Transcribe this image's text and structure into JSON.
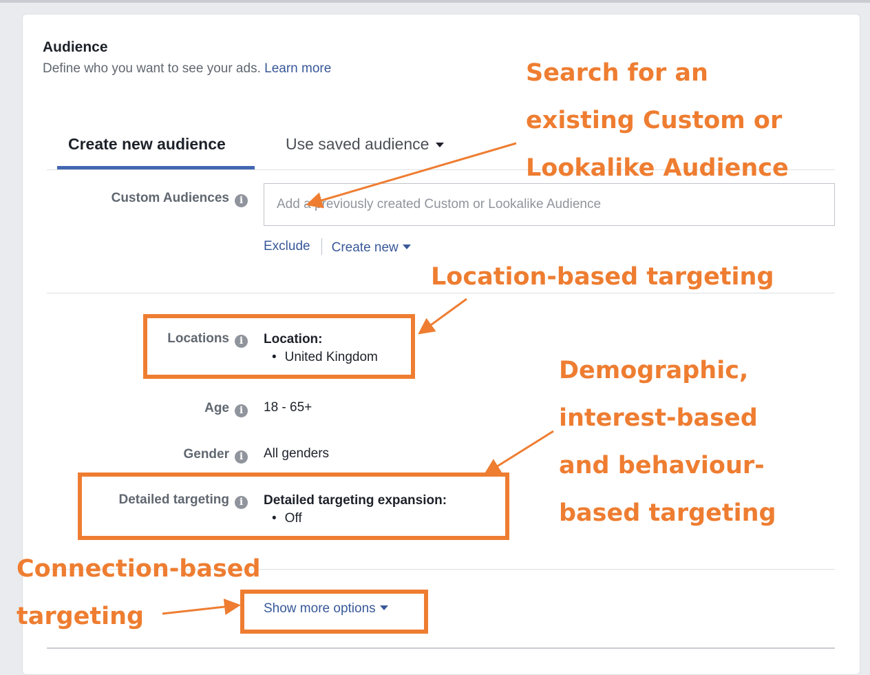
{
  "audience": {
    "title": "Audience",
    "subtitle": "Define who you want to see your ads.",
    "learn_more": "Learn more"
  },
  "tabs": [
    {
      "label": "Create new audience",
      "active": true
    },
    {
      "label": "Use saved audience",
      "active": false
    }
  ],
  "custom_audiences": {
    "label": "Custom Audiences",
    "placeholder": "Add a previously created Custom or Lookalike Audience",
    "exclude": "Exclude",
    "create_new": "Create new"
  },
  "locations": {
    "label": "Locations",
    "heading": "Location:",
    "items": [
      "United Kingdom"
    ]
  },
  "age": {
    "label": "Age",
    "value": "18 - 65+"
  },
  "gender": {
    "label": "Gender",
    "value": "All genders"
  },
  "detailed_targeting": {
    "label": "Detailed targeting",
    "heading": "Detailed targeting expansion:",
    "items": [
      "Off"
    ]
  },
  "show_more": "Show more options",
  "annotations": {
    "search": [
      "Search for an",
      "existing Custom or",
      "Lookalike Audience"
    ],
    "location": "Location-based targeting",
    "demographic": [
      "Demographic,",
      "interest-based",
      "and behaviour-",
      "based targeting"
    ],
    "connection": [
      "Connection-based",
      "targeting"
    ]
  },
  "colors": {
    "annotation": "#ee7d31",
    "link": "#385898",
    "tab_active": "#4267b2"
  }
}
